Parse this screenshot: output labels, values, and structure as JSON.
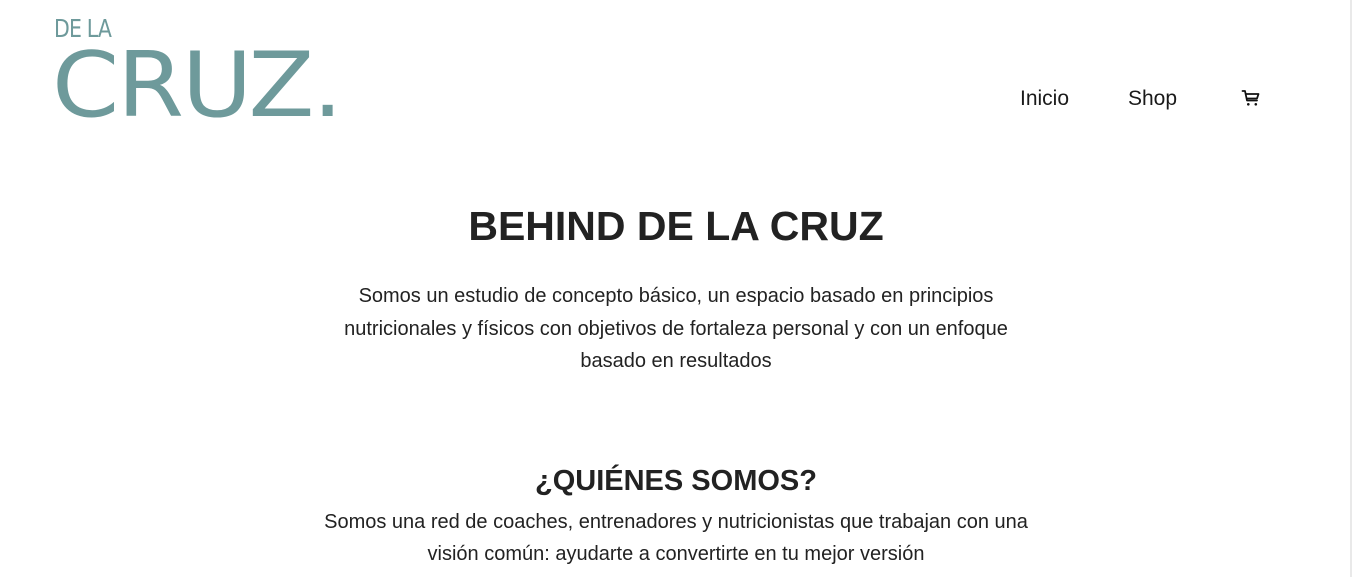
{
  "header": {
    "logo": {
      "top_text": "DE LA",
      "main_text": "CRUZ.",
      "color": "#6e9a9b"
    },
    "nav": [
      {
        "label": "Inicio"
      },
      {
        "label": "Shop"
      }
    ],
    "cart_icon": "shopping-cart-icon"
  },
  "main": {
    "hero": {
      "title": "BEHIND DE LA CRUZ",
      "text": "Somos un estudio de concepto básico, un espacio basado en principios nutricionales y físicos con objetivos de fortaleza personal y con un enfoque basado en resultados"
    },
    "about": {
      "title": "¿QUIÉNES SOMOS?",
      "text": "Somos una red de coaches, entrenadores y nutricionistas que trabajan con una visión común: ayudarte a convertirte en tu mejor versión"
    }
  }
}
